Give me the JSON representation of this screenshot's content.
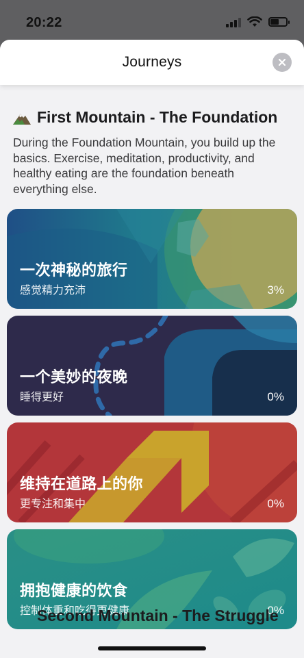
{
  "status_bar": {
    "time": "20:22"
  },
  "sheet": {
    "title": "Journeys",
    "close_icon": "close-icon"
  },
  "section": {
    "icon": "mountain-icon",
    "title": "First Mountain - The Foundation",
    "description": "During the Foundation Mountain, you build up the basics. Exercise, meditation, productivity, and healthy eating are the foundation beneath everything else."
  },
  "journeys": [
    {
      "title": "一次神秘的旅行",
      "subtitle": "感觉精力充沛",
      "progress": "3%",
      "color": "#2f7f8e"
    },
    {
      "title": "一个美妙的夜晚",
      "subtitle": "睡得更好",
      "progress": "0%",
      "color": "#2e2a4d"
    },
    {
      "title": "维持在道路上的你",
      "subtitle": "更专注和集中",
      "progress": "0%",
      "color": "#b8353a"
    },
    {
      "title": "拥抱健康的饮食",
      "subtitle": "控制体重和吃得更健康",
      "progress": "0%",
      "color": "#1f8c8a"
    }
  ],
  "next_section": {
    "title": "Second Mountain - The Struggle"
  }
}
